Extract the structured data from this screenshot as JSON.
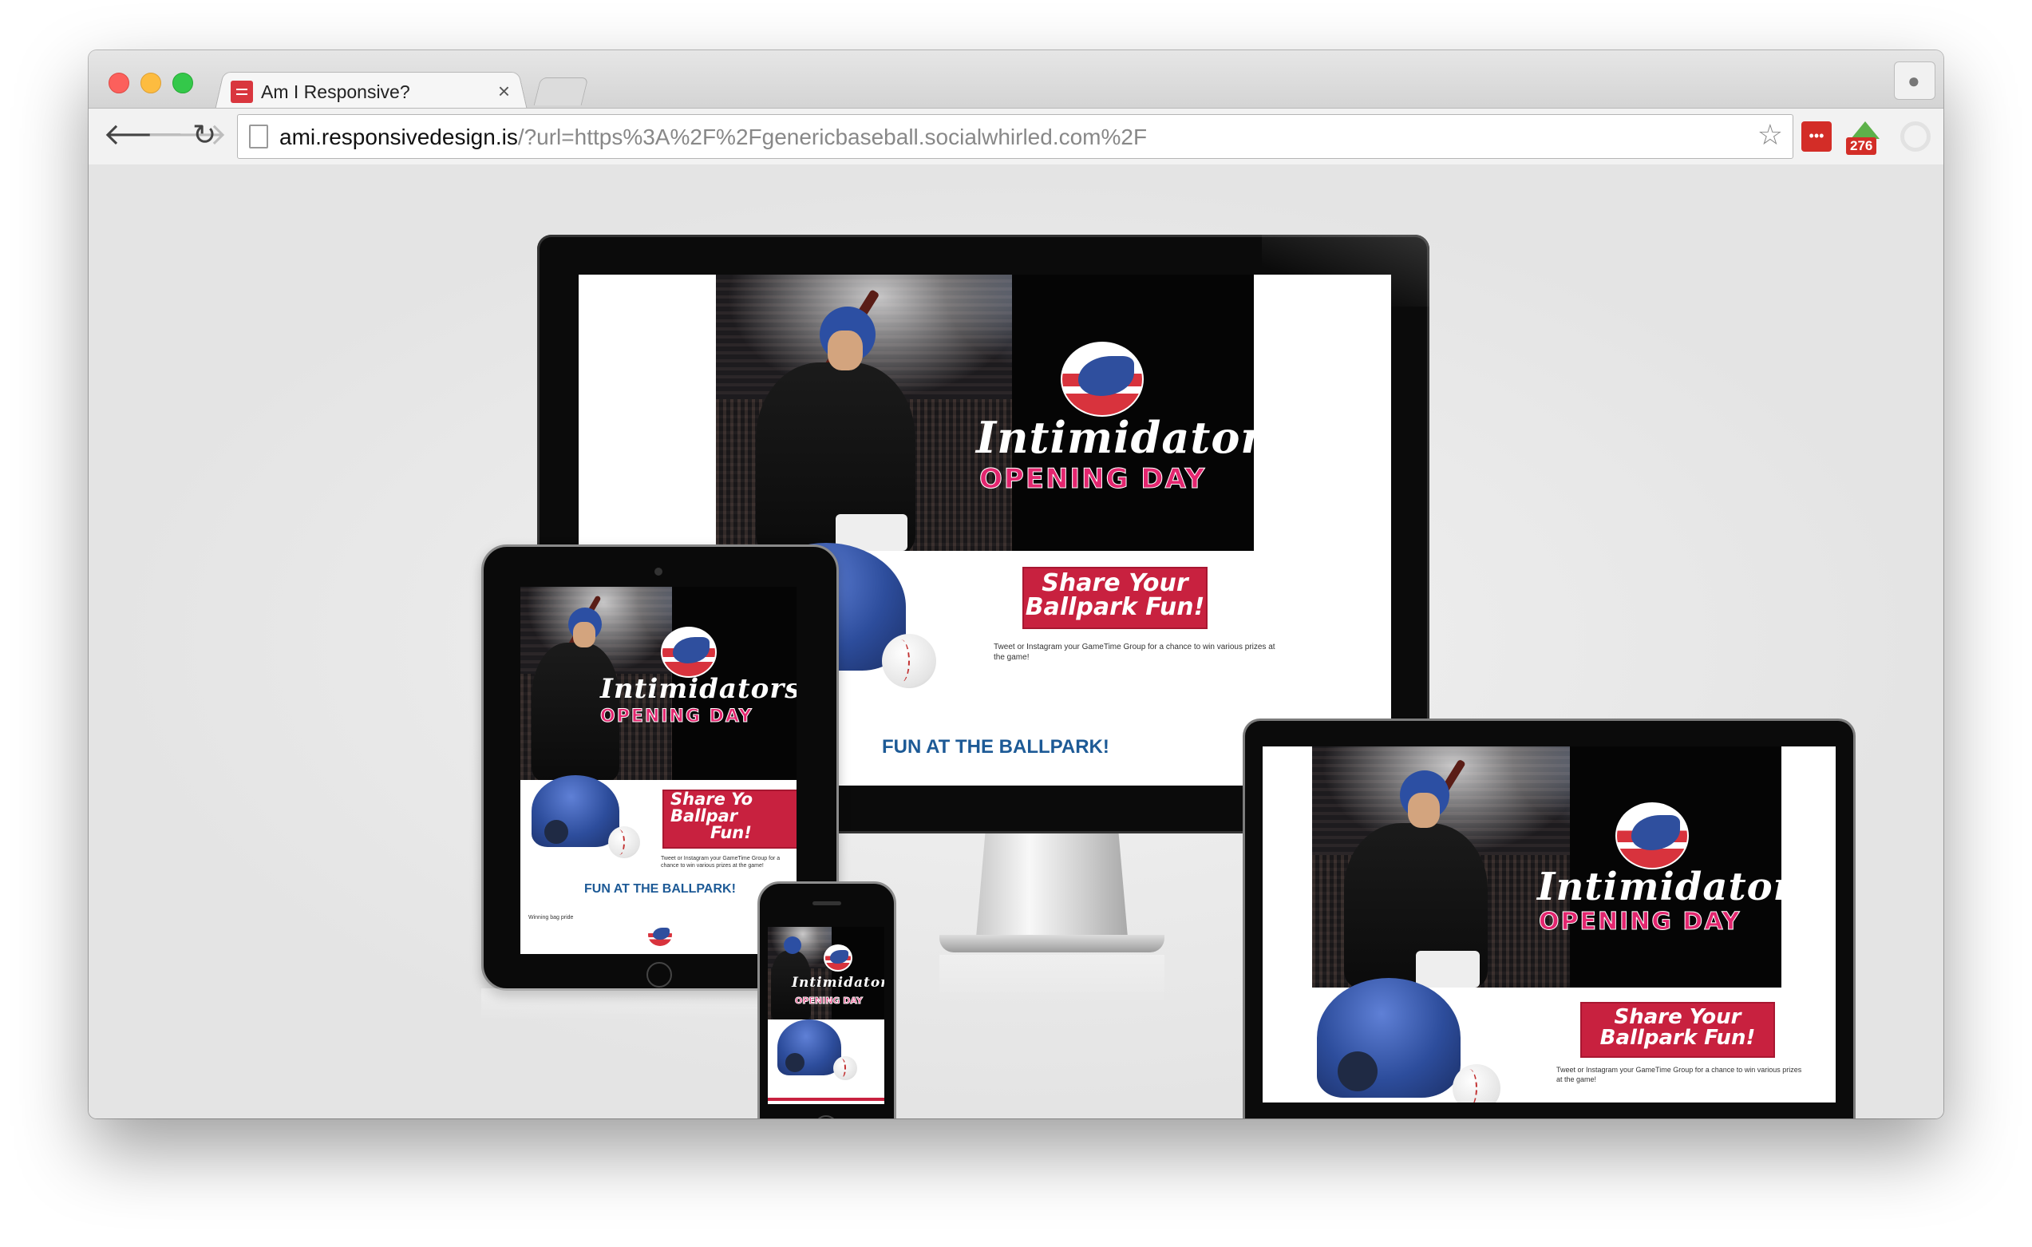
{
  "browser": {
    "tab_title": "Am I Responsive?",
    "tab_close": "×",
    "url_host": "ami.responsivedesign.is",
    "url_rest": "/?url=https%3A%2F%2Fgenericbaseball.socialwhirled.com%2F",
    "extension_badge_count": "276",
    "extension_lastpass_label": "•••"
  },
  "site": {
    "team_name": "Intimidators",
    "event": "OPENING DAY",
    "share_line1": "Share Your",
    "share_line2": "Ballpark Fun!",
    "share_short_line1": "Share Yo",
    "share_short_line2": "Ballpar",
    "share_short_line3": "Fun!",
    "description": "Tweet or Instagram your GameTime Group for a chance to win various prizes at the game!",
    "fun_heading": "FUN AT THE BALLPARK!",
    "tablet_caption": "Winning bag pride"
  },
  "colors": {
    "accent_red": "#c8213f",
    "pink": "#e3266f",
    "heading_blue": "#1d5a96",
    "helmet_blue": "#2d4d9c"
  }
}
